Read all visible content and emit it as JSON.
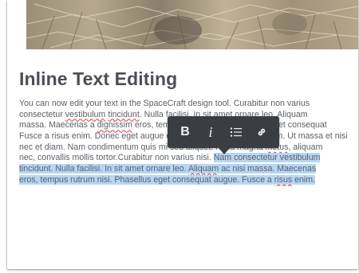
{
  "heading": {
    "title": "Inline Text Editing"
  },
  "paragraph": {
    "lines": [
      [
        {
          "t": "You can now edit your text in the SpaceCraft design tool. Curabitur non varius"
        }
      ],
      [
        {
          "t": "consectetur "
        },
        {
          "t": "vestibulum",
          "sp": true
        },
        {
          "t": " "
        },
        {
          "t": "tincidunt",
          "sp": true
        },
        {
          "t": ". Nulla facilisi. In sit amet ornare leo. Aliquam"
        }
      ],
      [
        {
          "t": "massa. Maecenas a "
        },
        {
          "t": "dignissim",
          "sp": true
        },
        {
          "t": " eros, tempus rutrum nisi. Phasellus eget consequat"
        }
      ],
      [
        {
          "t": "Fusce a risus enim. Donec eget augue eget massa tempus vestibulum. Ut massa et nisi sceleris"
        }
      ],
      [
        {
          "t": "nec et diam. Nam condimentum quis mi sed aliquet. Nulla magna "
        },
        {
          "t": "metus",
          "sp": true
        },
        {
          "t": ", aliquam"
        }
      ],
      [
        {
          "t": "nec, convallis mollis tortor.Curabitur non varius nisi. "
        },
        {
          "t": "Nam consectetur vestibulum",
          "hl": true
        }
      ],
      [
        {
          "t": "tincidunt. Nulla facilisi. In sit amet ornare leo. ",
          "hl": true
        },
        {
          "t": "Aliquam",
          "hl": true,
          "sp": true
        },
        {
          "t": " ac nisi massa. Maecenas",
          "hl": true
        }
      ],
      [
        {
          "t": "eros, tempus rutrum nisi. Phasellus eget consequat augue. Fusce a ",
          "hl": true
        },
        {
          "t": "risus",
          "hl": true,
          "sp": true
        },
        {
          "t": " enim.",
          "hl": true
        }
      ]
    ]
  },
  "toolbar": {
    "bold_label": "B",
    "italic_label": "i",
    "icons": [
      "bold-icon",
      "italic-icon",
      "bullet-list-icon",
      "link-icon"
    ]
  },
  "colors": {
    "toolbar_bg": "#3a3d42",
    "selection": "#b6d6f4",
    "heading": "#4b4f55",
    "text": "#5c6068",
    "spellcheck": "#d0443a"
  }
}
